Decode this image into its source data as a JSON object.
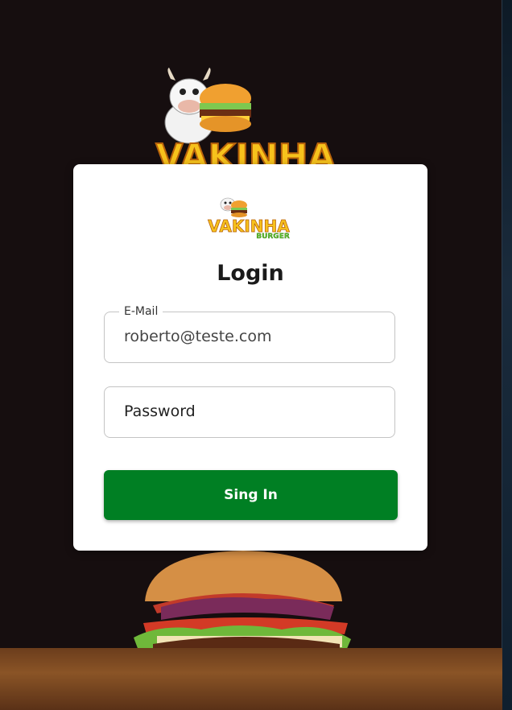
{
  "colors": {
    "background": "#160e0f",
    "card": "#ffffff",
    "primary_button": "#007f23",
    "title_text": "#1a1a1a"
  },
  "background": {
    "logo_text": "VAKINHA",
    "logo_icon": "cow-burger-mascot-icon",
    "hero_image": "burger-image"
  },
  "card": {
    "logo": {
      "title": "VAKINHA",
      "subtitle": "BURGER",
      "icon": "cow-burger-mascot-icon"
    },
    "title": "Login",
    "email": {
      "label": "E-Mail",
      "value": "roberto@teste.com"
    },
    "password": {
      "placeholder": "Password"
    },
    "submit_label": "Sing In"
  }
}
